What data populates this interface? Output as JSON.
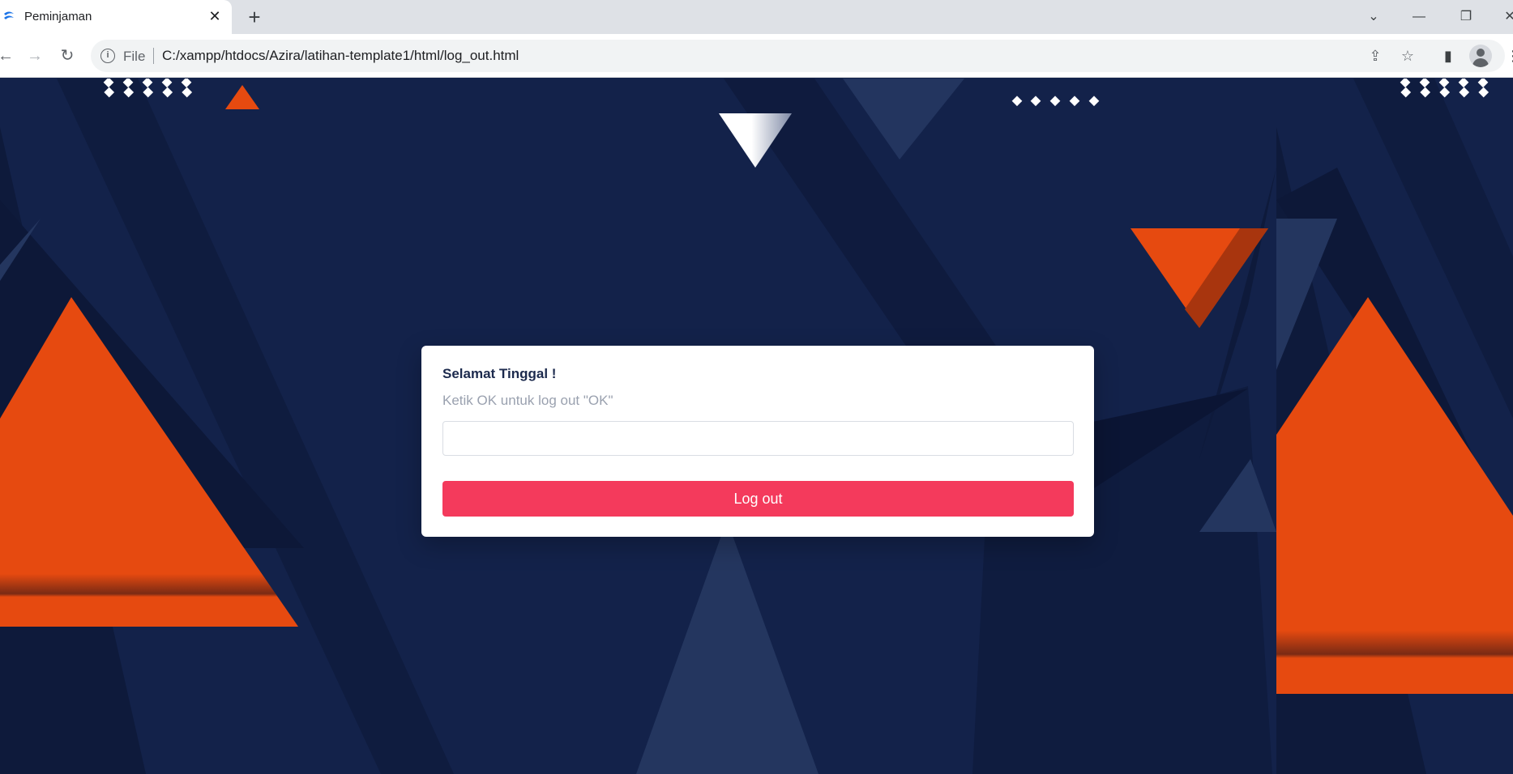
{
  "browser": {
    "tab": {
      "title": "Peminjaman",
      "close_glyph": "✕",
      "favicon": "swirl-favicon-icon"
    },
    "new_tab_glyph": "+",
    "window_controls": {
      "dropdown": "⌄",
      "minimize": "—",
      "restore": "❐",
      "close": "✕"
    },
    "nav": {
      "back": "←",
      "forward": "→",
      "reload": "↻"
    },
    "address": {
      "scheme": "File",
      "url": "C:/xampp/htdocs/Azira/latihan-template1/html/log_out.html",
      "info_glyph": "i"
    },
    "actions": {
      "share": "⇪",
      "bookmark": "☆",
      "side_panel": "▮",
      "menu": "⋮"
    }
  },
  "page": {
    "colors": {
      "navy": "#13224a",
      "orange": "#e64a10",
      "button": "#f43a5c"
    },
    "card": {
      "title": "Selamat Tinggal !",
      "hint": "Ketik OK untuk log out \"OK\"",
      "input_value": "",
      "button_label": "Log out"
    }
  }
}
